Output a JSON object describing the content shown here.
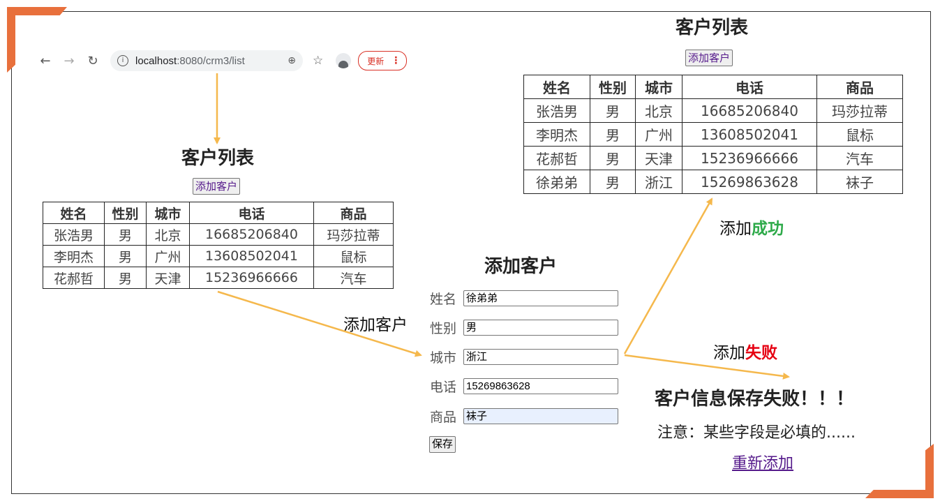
{
  "browser": {
    "url_host": "localhost",
    "url_path": ":8080/crm3/list",
    "update_label": "更新"
  },
  "list_before": {
    "title": "客户列表",
    "add_button": "添加客户",
    "headers": [
      "姓名",
      "性别",
      "城市",
      "电话",
      "商品"
    ],
    "rows": [
      [
        "张浩男",
        "男",
        "北京",
        "16685206840",
        "玛莎拉蒂"
      ],
      [
        "李明杰",
        "男",
        "广州",
        "13608502041",
        "鼠标"
      ],
      [
        "花郝哲",
        "男",
        "天津",
        "15236966666",
        "汽车"
      ]
    ]
  },
  "add_form": {
    "title": "添加客户",
    "fields": [
      {
        "label": "姓名",
        "value": "徐弟弟"
      },
      {
        "label": "性别",
        "value": "男"
      },
      {
        "label": "城市",
        "value": "浙江"
      },
      {
        "label": "电话",
        "value": "15269863628"
      },
      {
        "label": "商品",
        "value": "袜子"
      }
    ],
    "save_button": "保存"
  },
  "list_after": {
    "title": "客户列表",
    "add_button": "添加客户",
    "headers": [
      "姓名",
      "性别",
      "城市",
      "电话",
      "商品"
    ],
    "rows": [
      [
        "张浩男",
        "男",
        "北京",
        "16685206840",
        "玛莎拉蒂"
      ],
      [
        "李明杰",
        "男",
        "广州",
        "13608502041",
        "鼠标"
      ],
      [
        "花郝哲",
        "男",
        "天津",
        "15236966666",
        "汽车"
      ],
      [
        "徐弟弟",
        "男",
        "浙江",
        "15269863628",
        "袜子"
      ]
    ]
  },
  "labels": {
    "add_customer": "添加客户",
    "add_prefix": "添加",
    "success": "成功",
    "failure": "失败"
  },
  "error_page": {
    "title": "客户信息保存失败！！！",
    "note": "注意：某些字段是必填的......",
    "retry_link": "重新添加"
  },
  "colors": {
    "arrow": "#f5b84c",
    "success": "#2eaa4a",
    "failure": "#e60012",
    "corner_accent": "#e8703c"
  }
}
